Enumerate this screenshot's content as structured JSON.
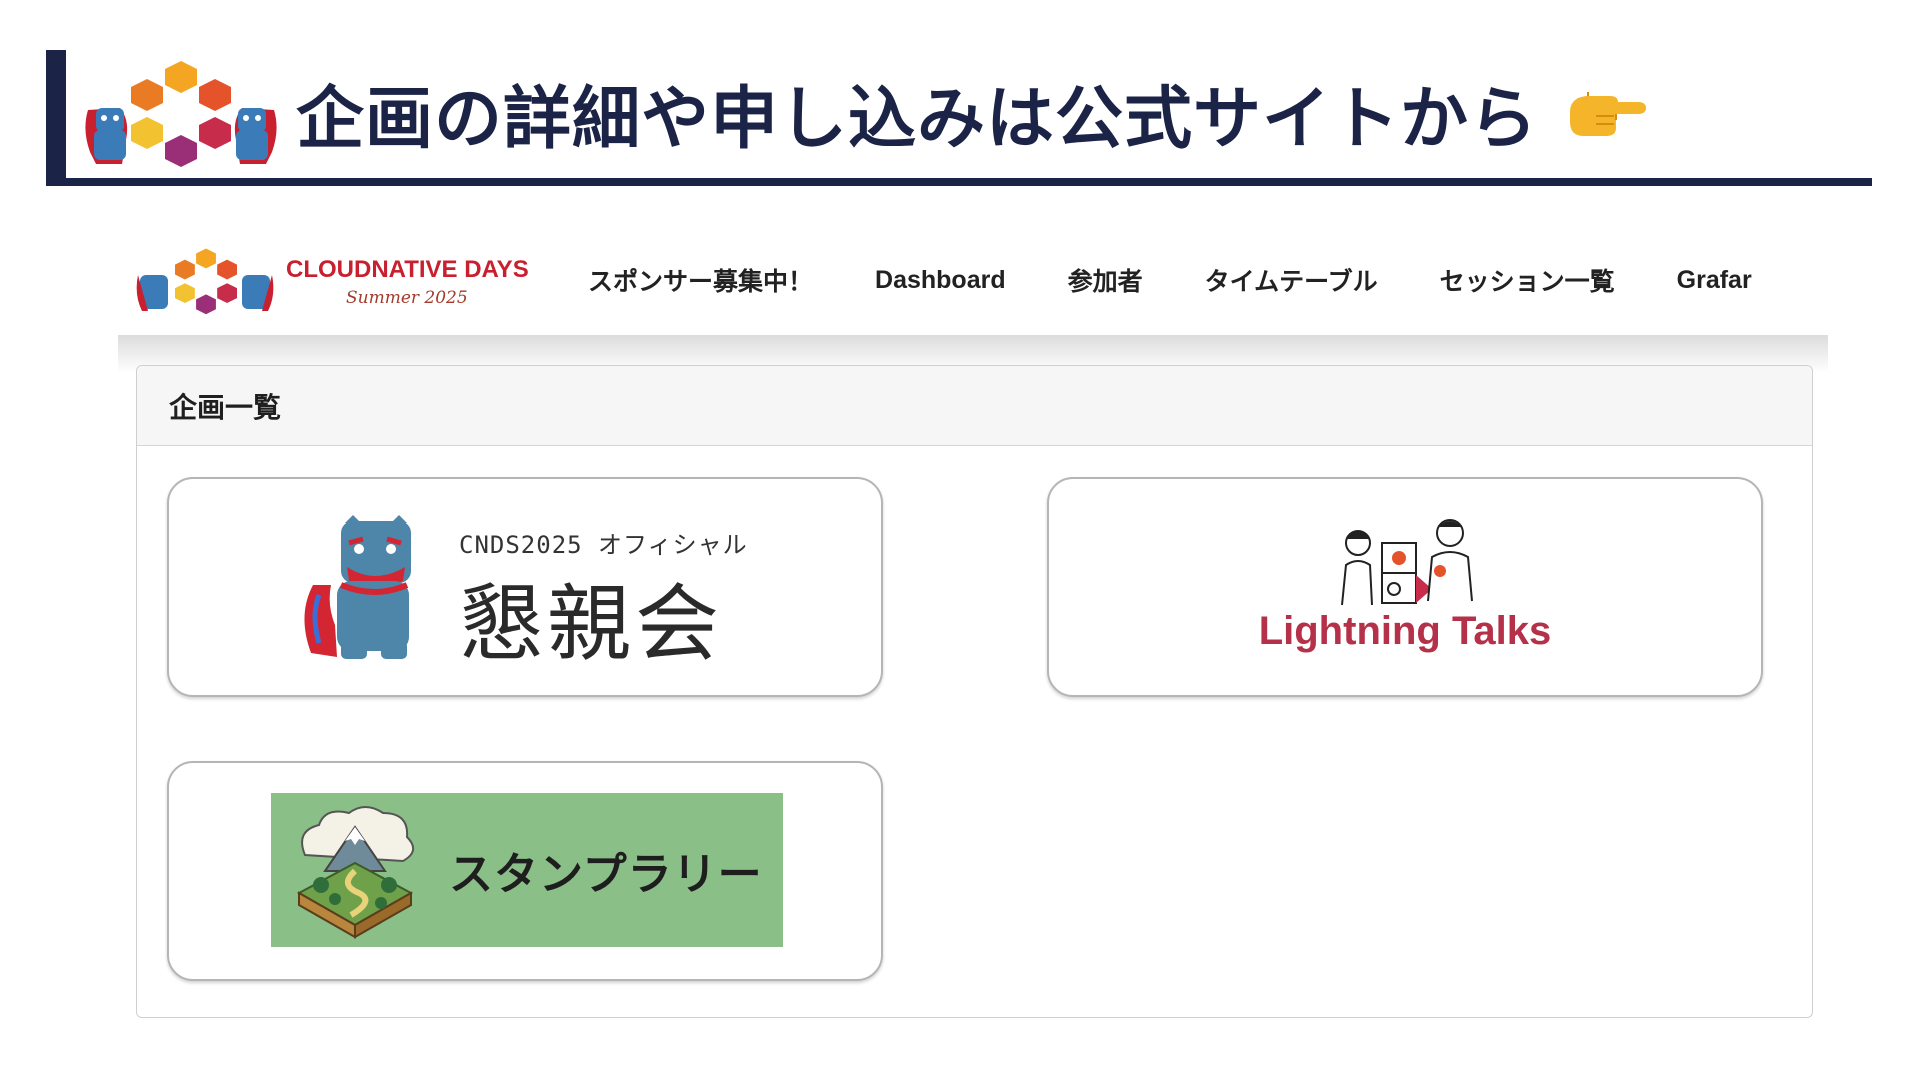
{
  "slide": {
    "title": "企画の詳細や申し込みは公式サイトから",
    "pointer_icon": "pointing-right-emoji-icon",
    "accent_color": "#1b2346"
  },
  "site": {
    "logo": {
      "brand": "CLOUDNATIVE DAYS",
      "subtitle": "Summer 2025"
    },
    "nav": {
      "items": [
        "スポンサー募集中！",
        "Dashboard",
        "参加者",
        "タイムテーブル",
        "セッション一覧",
        "Grafar"
      ]
    },
    "panel": {
      "title": "企画一覧"
    },
    "cards": {
      "konshinkai": {
        "sub": "CNDS2025 オフィシャル",
        "main": "懇親会",
        "icon": "shisa-icon"
      },
      "lightning_talks": {
        "label": "Lightning Talks",
        "icon": "speakers-illustration-icon",
        "color": "#b53149"
      },
      "stamp_rally": {
        "label": "スタンプラリー",
        "icon": "island-mountain-icon",
        "banner_color": "#8bbf88"
      }
    }
  }
}
